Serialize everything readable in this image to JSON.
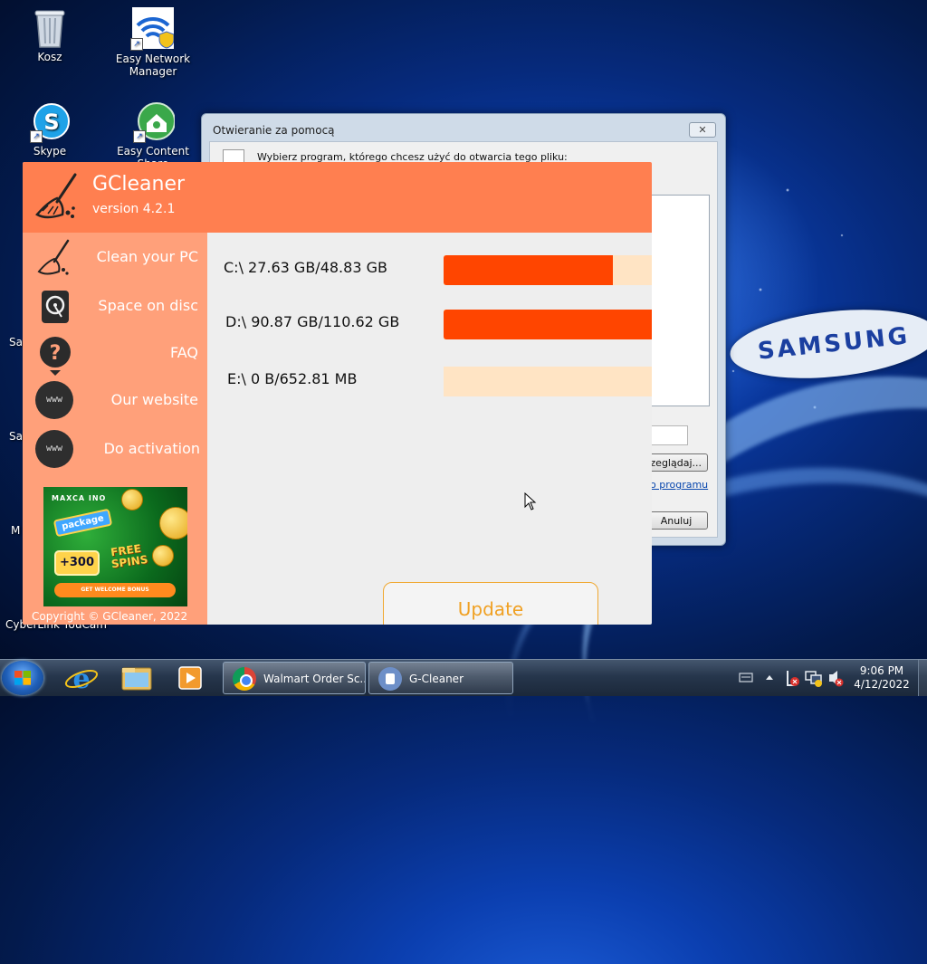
{
  "desktop": {
    "icons": [
      {
        "label": "Kosz"
      },
      {
        "label": "Easy Network Manager"
      },
      {
        "label": "Skype"
      },
      {
        "label": "Easy Content Share"
      }
    ],
    "cut_labels": [
      "Sa",
      "Sa",
      "M",
      "CyberLink YouCam"
    ],
    "wallpaper_brand": "SAMSUNG"
  },
  "open_with_dialog": {
    "title": "Otwieranie za pomocą",
    "close_glyph": "✕",
    "prompt": "Wybierz program, którego chcesz użyć do otwarcia tego pliku:",
    "browse_button": "zeglądaj...",
    "link_text": "o programu",
    "cancel_button": "Anuluj"
  },
  "gcleaner": {
    "title": "GCleaner",
    "version": "version 4.2.1",
    "nav": [
      {
        "label": "Clean your PC",
        "icon": "broom-icon"
      },
      {
        "label": "Space on disc",
        "icon": "hard-disk-icon"
      },
      {
        "label": "FAQ",
        "icon": "question-icon"
      },
      {
        "label": "Our website",
        "icon": "www-icon",
        "icon_text": "www"
      },
      {
        "label": "Do activation",
        "icon": "www-icon",
        "icon_text": "www"
      }
    ],
    "ad": {
      "brand": "MAXCA  INO",
      "package": "package",
      "bonus": "+300",
      "free_spins": "FREE SPINS",
      "cta": "GET WELCOME BONUS"
    },
    "copyright": "Copyright © GCleaner, 2022",
    "drives": [
      {
        "label": "C:\\ 27.63 GB/48.83 GB",
        "used_fraction": 0.815
      },
      {
        "label": "D:\\ 90.87 GB/110.62 GB",
        "used_fraction": 1.0
      },
      {
        "label": "E:\\ 0 B/652.81 MB",
        "used_fraction": 0.0
      }
    ],
    "update_button": "Update",
    "colors": {
      "header": "#ff7f50",
      "sidebar": "#ffa07a",
      "bar_fill": "#ff4500",
      "bar_track": "#ffe4c4",
      "update_text": "#f0a022"
    }
  },
  "taskbar": {
    "pinned": [
      "internet-explorer-icon",
      "windows-explorer-icon",
      "media-player-icon"
    ],
    "buttons": [
      {
        "label": "Walmart Order Sc...",
        "icon": "chrome-icon"
      },
      {
        "label": "G-Cleaner",
        "icon": "gcleaner-icon"
      }
    ],
    "clock": {
      "time": "9:06 PM",
      "date": "4/12/2022"
    }
  }
}
